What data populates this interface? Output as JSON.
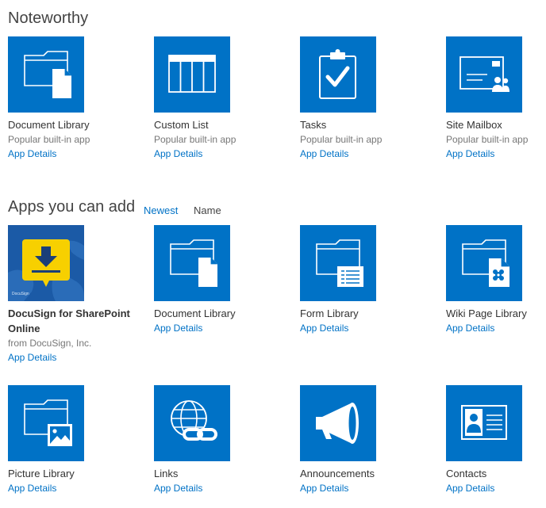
{
  "noteworthy": {
    "title": "Noteworthy",
    "apps": [
      {
        "name": "Document Library",
        "sub": "Popular built-in app",
        "details": "App Details",
        "icon": "document-library-icon"
      },
      {
        "name": "Custom List",
        "sub": "Popular built-in app",
        "details": "App Details",
        "icon": "custom-list-icon"
      },
      {
        "name": "Tasks",
        "sub": "Popular built-in app",
        "details": "App Details",
        "icon": "tasks-icon"
      },
      {
        "name": "Site Mailbox",
        "sub": "Popular built-in app",
        "details": "App Details",
        "icon": "site-mailbox-icon"
      }
    ]
  },
  "apps_section": {
    "title": "Apps you can add",
    "sort_newest": "Newest",
    "sort_name": "Name",
    "apps": [
      {
        "name_line1": "DocuSign for SharePoint",
        "name_line2": "Online",
        "sub": "from DocuSign, Inc.",
        "details": "App Details",
        "icon": "docusign-icon",
        "icon_label": "DocuSign"
      },
      {
        "name": "Document Library",
        "details": "App Details",
        "icon": "document-library-icon"
      },
      {
        "name": "Form Library",
        "details": "App Details",
        "icon": "form-library-icon"
      },
      {
        "name": "Wiki Page Library",
        "details": "App Details",
        "icon": "wiki-page-library-icon"
      },
      {
        "name": "Picture Library",
        "details": "App Details",
        "icon": "picture-library-icon"
      },
      {
        "name": "Links",
        "details": "App Details",
        "icon": "links-icon"
      },
      {
        "name": "Announcements",
        "details": "App Details",
        "icon": "announcements-icon"
      },
      {
        "name": "Contacts",
        "details": "App Details",
        "icon": "contacts-icon"
      }
    ]
  },
  "colors": {
    "tile_blue": "#0072c6",
    "link_blue": "#0072c6",
    "docusign_yellow": "#f7d000"
  }
}
